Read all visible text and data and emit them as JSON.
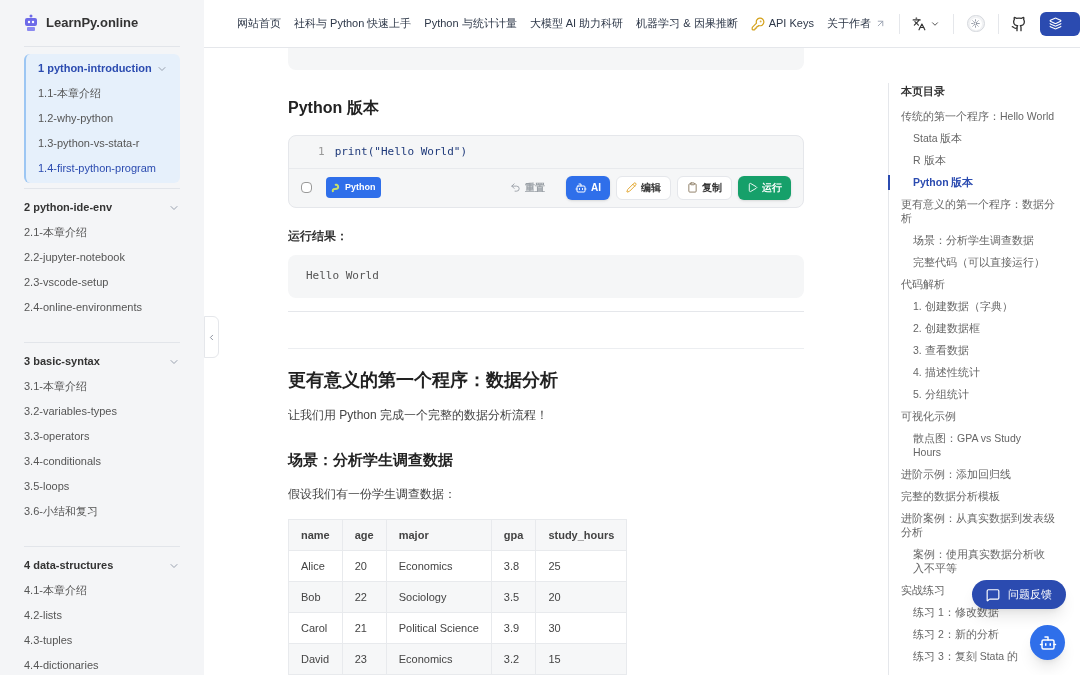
{
  "site": {
    "name": "LearnPy.online"
  },
  "nav": {
    "items": [
      {
        "label": "网站首页",
        "kind": "plain"
      },
      {
        "label": "社科与 Python 快速上手",
        "kind": "plain"
      },
      {
        "label": "Python 与统计计量",
        "kind": "plain"
      },
      {
        "label": "大模型 AI 助力科研",
        "kind": "plain"
      },
      {
        "label": "机器学习 & 因果推断",
        "kind": "plain"
      },
      {
        "label": "API Keys",
        "kind": "key"
      },
      {
        "label": "关于作者",
        "kind": "external"
      }
    ],
    "theme_toggle": {
      "on": false
    }
  },
  "sidebar": {
    "groups": [
      {
        "title": "1 python-introduction",
        "selected": true,
        "expanded": true,
        "children": [
          {
            "label": "1.1-本章介绍",
            "selected": false
          },
          {
            "label": "1.2-why-python",
            "selected": false
          },
          {
            "label": "1.3-python-vs-stata-r",
            "selected": false
          },
          {
            "label": "1.4-first-python-program",
            "selected": true
          }
        ]
      },
      {
        "title": "2 python-ide-env",
        "selected": false,
        "expanded": true,
        "children": [
          {
            "label": "2.1-本章介绍",
            "selected": false
          },
          {
            "label": "2.2-jupyter-notebook",
            "selected": false
          },
          {
            "label": "2.3-vscode-setup",
            "selected": false
          },
          {
            "label": "2.4-online-environments",
            "selected": false
          }
        ]
      },
      {
        "title": "3 basic-syntax",
        "selected": false,
        "expanded": true,
        "children": [
          {
            "label": "3.1-本章介绍",
            "selected": false
          },
          {
            "label": "3.2-variables-types",
            "selected": false
          },
          {
            "label": "3.3-operators",
            "selected": false
          },
          {
            "label": "3.4-conditionals",
            "selected": false
          },
          {
            "label": "3.5-loops",
            "selected": false
          },
          {
            "label": "3.6-小结和复习",
            "selected": false
          }
        ]
      },
      {
        "title": "4 data-structures",
        "selected": false,
        "expanded": true,
        "children": [
          {
            "label": "4.1-本章介绍",
            "selected": false
          },
          {
            "label": "4.2-lists",
            "selected": false
          },
          {
            "label": "4.3-tuples",
            "selected": false
          },
          {
            "label": "4.4-dictionaries",
            "selected": false
          }
        ]
      }
    ]
  },
  "content": {
    "python_heading": "Python 版本",
    "code_block": {
      "lines": [
        {
          "number": "1",
          "code": "print(\"Hello World\")"
        }
      ],
      "checkbox": {
        "checked": false
      },
      "language": "Python",
      "buttons": [
        {
          "label": "重置",
          "kind": "reset"
        },
        {
          "label": "AI",
          "kind": "ai"
        },
        {
          "label": "编辑",
          "kind": "edit"
        },
        {
          "label": "复制",
          "kind": "copy"
        },
        {
          "label": "运行",
          "kind": "run"
        }
      ]
    },
    "result_label": "运行结果：",
    "output": "Hello World",
    "section_heading": "更有意义的第一个程序：数据分析",
    "intro": "让我们用 Python 完成一个完整的数据分析流程！",
    "scenario_heading": "场景：分析学生调查数据",
    "scenario_text": "假设我们有一份学生调查数据：",
    "table": {
      "columns": [
        "name",
        "age",
        "major",
        "gpa",
        "study_hours"
      ],
      "rows": [
        [
          "Alice",
          "20",
          "Economics",
          "3.8",
          "25"
        ],
        [
          "Bob",
          "22",
          "Sociology",
          "3.5",
          "20"
        ],
        [
          "Carol",
          "21",
          "Political Science",
          "3.9",
          "30"
        ],
        [
          "David",
          "23",
          "Economics",
          "3.2",
          "15"
        ]
      ]
    }
  },
  "toc": {
    "title": "本页目录",
    "items": [
      {
        "label": "传统的第一个程序：Hello World",
        "selected": false,
        "children": [
          {
            "label": "Stata 版本",
            "selected": false
          },
          {
            "label": "R 版本",
            "selected": false
          },
          {
            "label": "Python 版本",
            "selected": true
          }
        ]
      },
      {
        "label": "更有意义的第一个程序：数据分析",
        "selected": false,
        "children": [
          {
            "label": "场景：分析学生调查数据",
            "selected": false
          },
          {
            "label": "完整代码（可以直接运行）",
            "selected": false
          }
        ]
      },
      {
        "label": "代码解析",
        "selected": false,
        "children": [
          {
            "label": "1. 创建数据（字典）",
            "selected": false
          },
          {
            "label": "2. 创建数据框",
            "selected": false
          },
          {
            "label": "3. 查看数据",
            "selected": false
          },
          {
            "label": "4. 描述性统计",
            "selected": false
          },
          {
            "label": "5. 分组统计",
            "selected": false
          }
        ]
      },
      {
        "label": "可视化示例",
        "selected": false,
        "children": [
          {
            "label": "散点图：GPA vs Study Hours",
            "selected": false
          }
        ]
      },
      {
        "label": "进阶示例：添加回归线",
        "selected": false
      },
      {
        "label": "完整的数据分析模板",
        "selected": false
      },
      {
        "label": "进阶案例：从真实数据到发表级分析",
        "selected": false,
        "children": [
          {
            "label": "案例：使用真实数据分析收入不平等",
            "selected": false
          }
        ]
      },
      {
        "label": "实战练习",
        "selected": false,
        "children": [
          {
            "label": "练习 1：修改数据",
            "selected": false
          },
          {
            "label": "练习 2：新的分析",
            "selected": false
          },
          {
            "label": "练习 3：复刻 Stata 的",
            "selected": false
          }
        ]
      }
    ]
  },
  "feedback_button": {
    "label": "问题反馈"
  }
}
